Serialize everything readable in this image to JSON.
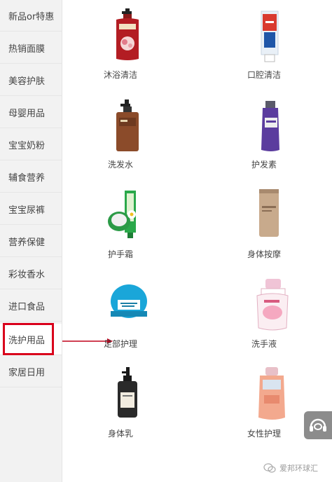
{
  "sidebar": {
    "items": [
      {
        "label": "新品or特惠"
      },
      {
        "label": "热销面膜"
      },
      {
        "label": "美容护肤"
      },
      {
        "label": "母婴用品"
      },
      {
        "label": "宝宝奶粉"
      },
      {
        "label": "辅食营养"
      },
      {
        "label": "宝宝尿裤"
      },
      {
        "label": "营养保健"
      },
      {
        "label": "彩妆香水"
      },
      {
        "label": "进口食品"
      },
      {
        "label": "洗护用品"
      },
      {
        "label": "家居日用"
      }
    ],
    "active_label": "洗护用品"
  },
  "products": [
    {
      "label": "沐浴清洁",
      "icon": "body-wash-bottle-icon"
    },
    {
      "label": "口腔清洁",
      "icon": "toothpaste-icon"
    },
    {
      "label": "洗发水",
      "icon": "shampoo-bottle-icon"
    },
    {
      "label": "护发素",
      "icon": "conditioner-bottle-icon"
    },
    {
      "label": "护手霜",
      "icon": "hand-cream-icon"
    },
    {
      "label": "身体按摩",
      "icon": "massage-tube-icon"
    },
    {
      "label": "足部护理",
      "icon": "foot-cream-jar-icon"
    },
    {
      "label": "洗手液",
      "icon": "hand-soap-icon"
    },
    {
      "label": "身体乳",
      "icon": "body-lotion-bottle-icon"
    },
    {
      "label": "女性护理",
      "icon": "feminine-care-bottle-icon"
    }
  ],
  "watermark": {
    "text": "爱邦环球汇",
    "icon": "wechat-icon"
  },
  "support_button": {
    "icon": "headset-icon"
  },
  "colors": {
    "highlight": "#d9001b",
    "sidebar_bg": "#f2f2f2"
  }
}
